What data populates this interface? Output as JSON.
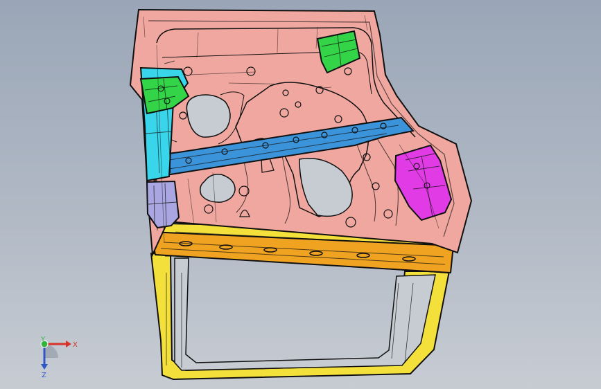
{
  "viewport": {
    "background_top": "#9aa6b7",
    "background_bottom": "#c7ccd3"
  },
  "colors": {
    "inner_panel": "#f0a7a0",
    "frame": "#f4e03a",
    "beam": "#f0a320",
    "bracket_blue": "#3b93d9",
    "bracket_cyan": "#39d5ea",
    "bracket_green": "#33d447",
    "bracket_magenta": "#e13be5",
    "bracket_lavender": "#a9a6e2",
    "edge": "#101010"
  },
  "axis_triad": {
    "x_label": "X",
    "y_label": "Y",
    "z_label": "Z",
    "x_color": "#d8322b",
    "y_color": "#35b53f",
    "z_color": "#2f57c7"
  }
}
